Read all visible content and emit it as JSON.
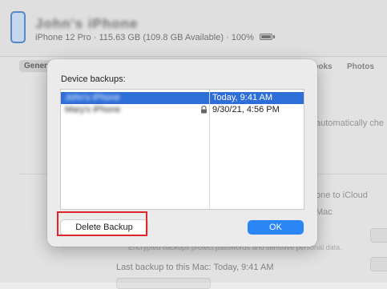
{
  "background": {
    "device_name": "John's iPhone",
    "device_info": "iPhone 12 Pro · 115.63 GB (109.8 GB Available) · 100%",
    "tabs": [
      "General",
      "Books",
      "Photos"
    ],
    "partial_texts": {
      "automatically": "automatically che",
      "icloud": "one to iCloud",
      "mac": "Mac",
      "encrypted": "Encrypted backups protect passwords and sensitive personal data.",
      "last_backup": "Last backup to this Mac: Today, 9:41 AM"
    }
  },
  "dialog": {
    "title": "Device backups:",
    "backups": [
      {
        "name": "John's iPhone",
        "date": "Today,  9:41 AM",
        "locked": false,
        "selected": true
      },
      {
        "name": "Mary's iPhone",
        "date": "9/30/21, 4:56 PM",
        "locked": true,
        "selected": false
      }
    ],
    "delete_label": "Delete Backup",
    "ok_label": "OK"
  },
  "colors": {
    "selection": "#2e6ed8",
    "ok_button": "#2a86f7",
    "highlight_box": "#e0262c"
  },
  "icons": {
    "lock": "lock-icon",
    "phone": "iphone-icon",
    "battery": "battery-icon"
  }
}
